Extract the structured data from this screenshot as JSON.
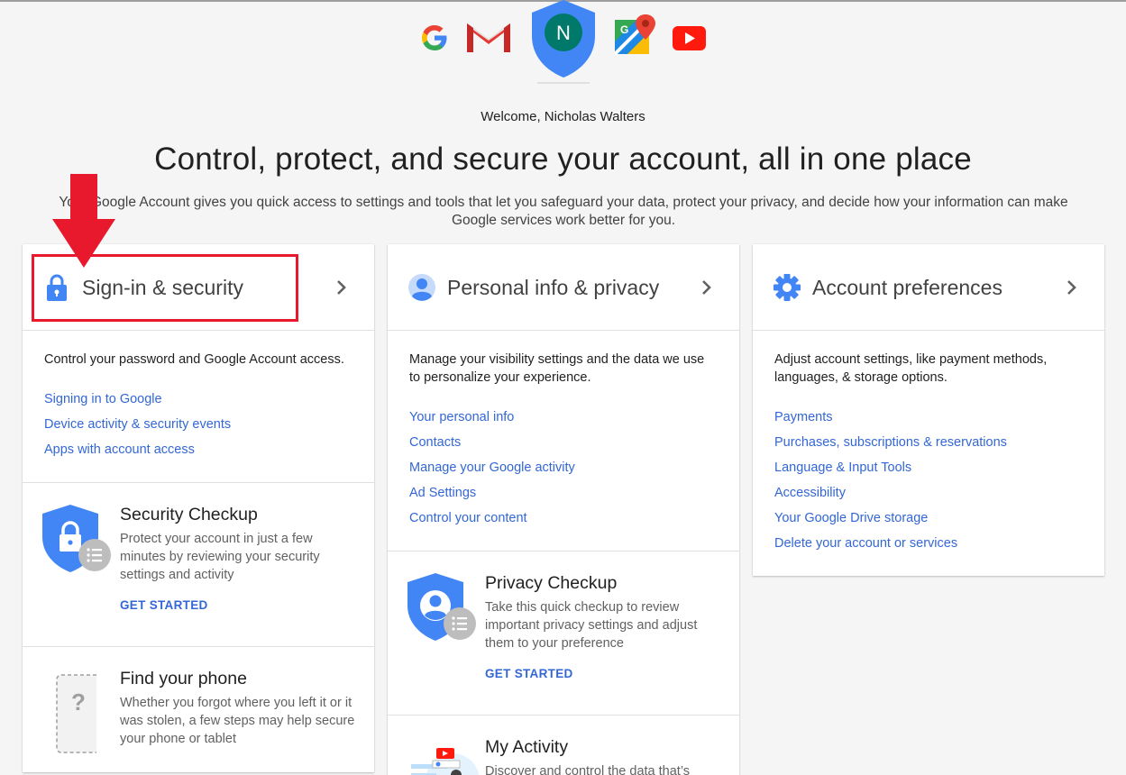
{
  "header": {
    "avatar_initial": "N",
    "welcome": "Welcome, Nicholas Walters",
    "headline": "Control, protect, and secure your account, all in one place",
    "intro": "Your Google Account gives you quick access to settings and tools that let you safeguard your data, protect your privacy, and decide how your information can make Google services work better for you.",
    "apps": [
      "google-icon",
      "gmail-icon",
      "maps-icon",
      "youtube-icon"
    ]
  },
  "colors": {
    "link": "#3367d6",
    "icon_blue": "#4285f4",
    "annotation_red": "#e8192c",
    "avatar_green": "#00796b"
  },
  "columns": [
    {
      "title": "Sign-in & security",
      "icon": "lock-icon",
      "description": "Control your password and Google Account access.",
      "links": [
        "Signing in to Google",
        "Device activity & security events",
        "Apps with account access"
      ],
      "subcards": [
        {
          "title": "Security Checkup",
          "description": "Protect your account in just a few minutes by reviewing your security settings and activity",
          "cta": "GET STARTED"
        },
        {
          "title": "Find your phone",
          "description": "Whether you forgot where you left it or it was stolen, a few steps may help secure your phone or tablet"
        }
      ]
    },
    {
      "title": "Personal info & privacy",
      "icon": "person-icon",
      "description": "Manage your visibility settings and the data we use to personalize your experience.",
      "links": [
        "Your personal info",
        "Contacts",
        "Manage your Google activity",
        "Ad Settings",
        "Control your content"
      ],
      "subcards": [
        {
          "title": "Privacy Checkup",
          "description": "Take this quick checkup to review important privacy settings and adjust them to your preference",
          "cta": "GET STARTED"
        },
        {
          "title": "My Activity",
          "description": "Discover and control the data that’s"
        }
      ]
    },
    {
      "title": "Account preferences",
      "icon": "gear-icon",
      "description": "Adjust account settings, like payment methods, languages, & storage options.",
      "links": [
        "Payments",
        "Purchases, subscriptions & reservations",
        "Language & Input Tools",
        "Accessibility",
        "Your Google Drive storage",
        "Delete your account or services"
      ]
    }
  ]
}
